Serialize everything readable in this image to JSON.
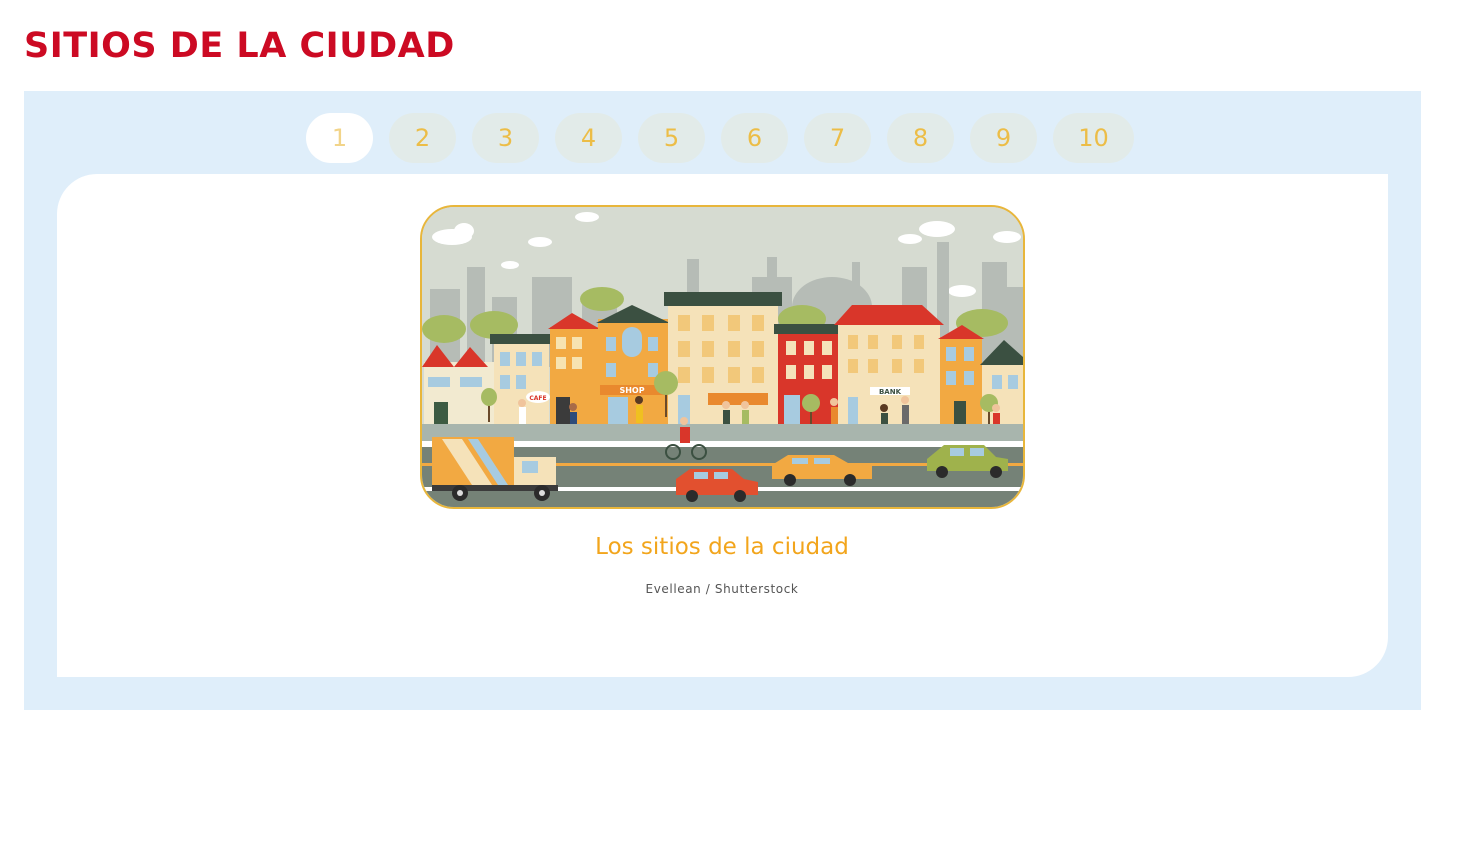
{
  "header": {
    "title": "SITIOS DE LA CIUDAD"
  },
  "pager": {
    "pages": [
      "1",
      "2",
      "3",
      "4",
      "5",
      "6",
      "7",
      "8",
      "9",
      "10"
    ],
    "active": "1"
  },
  "slide": {
    "illustration": {
      "sign_cafe": "CAFE",
      "sign_shop": "SHOP",
      "sign_bank": "BANK"
    },
    "caption": "Los sitios de la ciudad",
    "credit": "Evellean / Shutterstock"
  },
  "colors": {
    "title": "#cc0a23",
    "panel": "#dfeefa",
    "pager_idle": "#e2ebe9",
    "pager_text": "#ecbd47",
    "caption": "#f2a51c",
    "image_border": "#e8b63b"
  },
  "icons": {
    "slide_image": "city-street-illustration"
  }
}
